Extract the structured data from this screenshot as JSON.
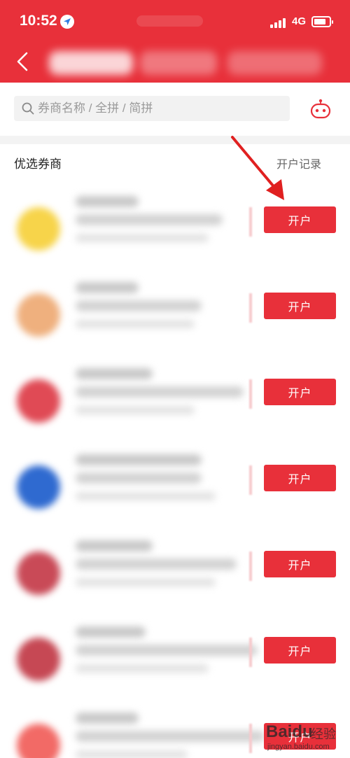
{
  "status_bar": {
    "time": "10:52",
    "network": "4G"
  },
  "search": {
    "placeholder": "券商名称 / 全拼 / 简拼"
  },
  "section": {
    "title": "优选券商",
    "records_link": "开户记录"
  },
  "brokers": [
    {
      "open_label": "开户",
      "logo_color": "#f7d44a"
    },
    {
      "open_label": "开户",
      "logo_color": "#efb07e"
    },
    {
      "open_label": "开户",
      "logo_color": "#e04a55"
    },
    {
      "open_label": "开户",
      "logo_color": "#2f6ad0"
    },
    {
      "open_label": "开户",
      "logo_color": "#c94a57"
    },
    {
      "open_label": "开户",
      "logo_color": "#c64854"
    },
    {
      "open_label": "开户",
      "logo_color": "#f26a66"
    }
  ],
  "watermark": {
    "brand": "Baidu",
    "jingyan": "经验",
    "url": "jingyan.baidu.com"
  },
  "colors": {
    "brand_red": "#e8303a",
    "annotation_arrow": "#e02020"
  }
}
